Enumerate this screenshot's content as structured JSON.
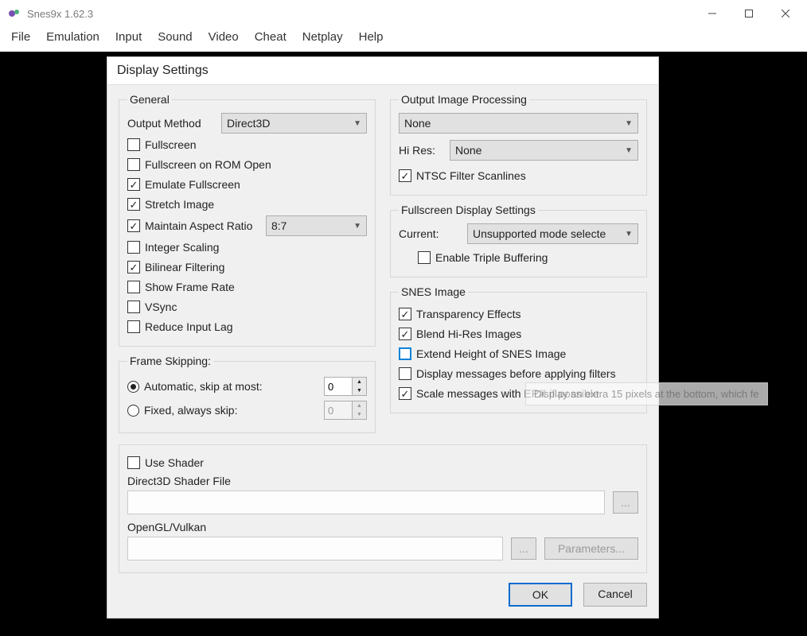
{
  "window": {
    "title": "Snes9x 1.62.3"
  },
  "menubar": [
    "File",
    "Emulation",
    "Input",
    "Sound",
    "Video",
    "Cheat",
    "Netplay",
    "Help"
  ],
  "dialog": {
    "title": "Display Settings",
    "general": {
      "legend": "General",
      "output_method_label": "Output Method",
      "output_method_value": "Direct3D",
      "fullscreen": "Fullscreen",
      "fullscreen_on_rom": "Fullscreen on ROM Open",
      "emulate_fullscreen": "Emulate Fullscreen",
      "stretch_image": "Stretch Image",
      "maintain_aspect": "Maintain Aspect Ratio",
      "aspect_value": "8:7",
      "integer_scaling": "Integer Scaling",
      "bilinear": "Bilinear Filtering",
      "show_framerate": "Show Frame Rate",
      "vsync": "VSync",
      "reduce_input_lag": "Reduce Input Lag"
    },
    "frame_skipping": {
      "legend": "Frame Skipping:",
      "automatic": "Automatic, skip at most:",
      "automatic_value": "0",
      "fixed": "Fixed, always skip:",
      "fixed_value": "0"
    },
    "output_proc": {
      "legend": "Output Image Processing",
      "main_value": "None",
      "hires_label": "Hi Res:",
      "hires_value": "None",
      "ntsc_scanlines": "NTSC Filter Scanlines"
    },
    "fullscreen_settings": {
      "legend": "Fullscreen Display Settings",
      "current_label": "Current:",
      "current_value": "Unsupported mode selecte",
      "triple_buffering": "Enable Triple Buffering"
    },
    "snes_image": {
      "legend": "SNES Image",
      "transparency": "Transparency Effects",
      "blend_hires": "Blend Hi-Res Images",
      "extend_height": "Extend Height of SNES Image",
      "display_messages": "Display messages before applying filters",
      "scale_messages": "Scale messages with EPX if possible"
    },
    "shader": {
      "use_shader": "Use Shader",
      "d3d_label": "Direct3D Shader File",
      "ogl_label": "OpenGL/Vulkan",
      "browse": "...",
      "parameters": "Parameters..."
    },
    "actions": {
      "ok": "OK",
      "cancel": "Cancel"
    }
  },
  "tooltip": "Display an extra 15 pixels at the bottom, which fe"
}
